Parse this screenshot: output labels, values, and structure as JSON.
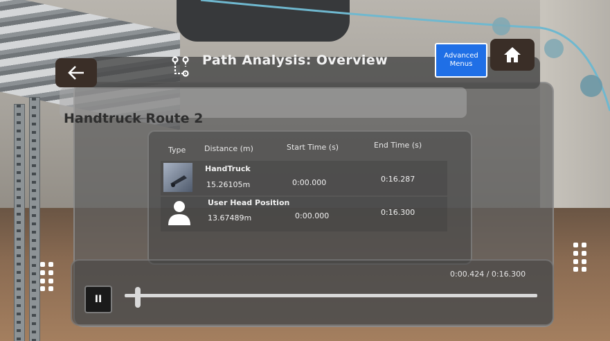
{
  "header": {
    "title": "Path Analysis: Overview",
    "advanced_menus": "Advanced Menus"
  },
  "route": {
    "name": "Handtruck Route 2"
  },
  "table": {
    "columns": [
      "Type",
      "Distance (m)",
      "Start Time (s)",
      "End Time (s)"
    ],
    "rows": [
      {
        "icon": "handtruck-icon",
        "name": "HandTruck",
        "distance": "15.26105m",
        "start": "0:00.000",
        "end": "0:16.287"
      },
      {
        "icon": "user-head-icon",
        "name": "User Head Position",
        "distance": "13.67489m",
        "start": "0:00.000",
        "end": "0:16.300"
      }
    ]
  },
  "timeline": {
    "time_display": "0:00.424 / 0:16.300",
    "progress": 0.026,
    "pause_label": "II"
  },
  "colors": {
    "accent": "#1f6fe6",
    "button_dark": "#3a2e27",
    "path_line": "#6fb8cf"
  }
}
